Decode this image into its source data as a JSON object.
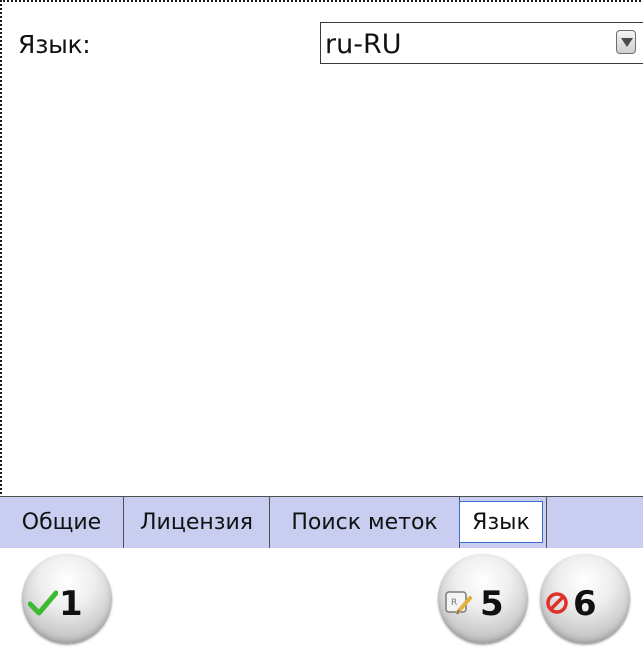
{
  "language_row": {
    "label": "Язык:",
    "selected_value": "ru-RU"
  },
  "tabs": [
    {
      "label": "Общие",
      "active": false
    },
    {
      "label": "Лицензия",
      "active": false
    },
    {
      "label": "Поиск меток",
      "active": false
    },
    {
      "label": "Язык",
      "active": true
    }
  ],
  "command_bar": {
    "ok_key": "1",
    "edit_key": "5",
    "cancel_key": "6",
    "icons": {
      "ok": "check-icon",
      "edit": "edit-icon",
      "cancel": "cancel-icon"
    }
  },
  "colors": {
    "tab_bar_bg": "#c9cdef",
    "active_tab_border": "#3d6fd0",
    "check_green": "#3dbb2f",
    "cancel_red": "#e0302a"
  }
}
